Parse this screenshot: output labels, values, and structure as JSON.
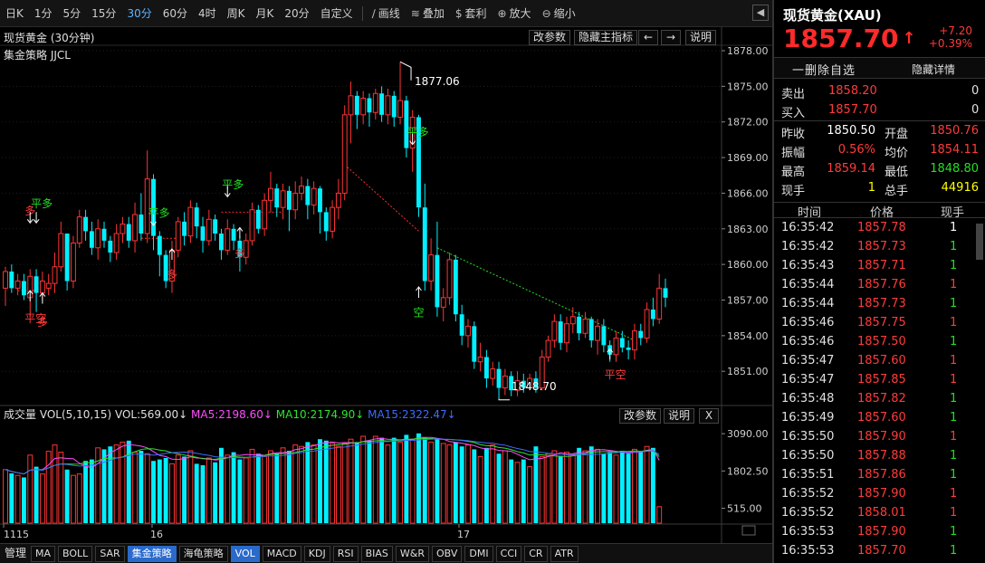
{
  "toolbar": {
    "items": [
      {
        "label": "日K",
        "active": false
      },
      {
        "label": "1分",
        "active": false
      },
      {
        "label": "5分",
        "active": false
      },
      {
        "label": "15分",
        "active": false
      },
      {
        "label": "30分",
        "active": true
      },
      {
        "label": "60分",
        "active": false
      },
      {
        "label": "4时",
        "active": false
      },
      {
        "label": "周K",
        "active": false
      },
      {
        "label": "月K",
        "active": false
      },
      {
        "label": "20分",
        "active": false
      },
      {
        "label": "自定义",
        "active": false
      }
    ],
    "tools": [
      {
        "icon": "draw-line-icon",
        "glyph": "∕",
        "label": "画线"
      },
      {
        "icon": "overlay-icon",
        "glyph": "≋",
        "label": "叠加"
      },
      {
        "icon": "arbitrage-icon",
        "glyph": "$",
        "label": "套利"
      },
      {
        "icon": "zoom-in-icon",
        "glyph": "⊕",
        "label": "放大"
      },
      {
        "icon": "zoom-out-icon",
        "glyph": "⊖",
        "label": "缩小"
      }
    ],
    "collapse_glyph": "◀"
  },
  "main_chart": {
    "title": "现货黄金 (30分钟)",
    "strategy": "集金策略 JJCL",
    "buttons": {
      "edit_params": "改参数",
      "hide_indicator": "隐藏主指标",
      "prev": "←",
      "next": "→",
      "help": "说明"
    },
    "high_label": "1877.06",
    "low_label": "1848.70",
    "signals": [
      "多",
      "平多",
      "平空",
      "多",
      "平多",
      "多",
      "平多",
      "多",
      "平多",
      "空",
      "平空"
    ]
  },
  "volume_panel": {
    "title": "成交量",
    "vol_label": "VOL(5,10,15)",
    "vol_value": "VOL:569.00↓",
    "ma5": "MA5:2198.60↓",
    "ma10": "MA10:2174.90↓",
    "ma15": "MA15:2322.47↓",
    "buttons": {
      "edit_params": "改参数",
      "help": "说明",
      "close": "X"
    },
    "axis_ticks": [
      "3090.00",
      "1802.50",
      "515.00"
    ]
  },
  "x_axis_labels": [
    "1115",
    "16",
    "17"
  ],
  "bottom_tabs": {
    "manage": "管理",
    "tabs": [
      "MA",
      "BOLL",
      "SAR",
      "集金策略",
      "海龟策略",
      "VOL",
      "MACD",
      "KDJ",
      "RSI",
      "BIAS",
      "W&R",
      "OBV",
      "DMI",
      "CCI",
      "CR",
      "ATR"
    ],
    "selected": [
      "集金策略",
      "VOL"
    ]
  },
  "chart_data": {
    "type": "candlestick",
    "y_ticks": [
      "1878.00",
      "1875.00",
      "1872.00",
      "1869.00",
      "1866.00",
      "1863.00",
      "1860.00",
      "1857.00",
      "1854.00",
      "1851.00"
    ],
    "ylim": [
      1848.5,
      1878.0
    ],
    "candles": [
      {
        "o": 1858.0,
        "c": 1859.4,
        "h": 1859.8,
        "l": 1856.5
      },
      {
        "o": 1859.4,
        "c": 1858.0,
        "h": 1860.0,
        "l": 1857.6
      },
      {
        "o": 1858.0,
        "c": 1858.6,
        "h": 1859.2,
        "l": 1857.4
      },
      {
        "o": 1858.6,
        "c": 1857.4,
        "h": 1859.2,
        "l": 1857.0
      },
      {
        "o": 1857.2,
        "c": 1859.0,
        "h": 1859.6,
        "l": 1855.6
      },
      {
        "o": 1859.0,
        "c": 1857.6,
        "h": 1859.6,
        "l": 1856.0
      },
      {
        "o": 1857.6,
        "c": 1858.6,
        "h": 1859.4,
        "l": 1857.0
      },
      {
        "o": 1858.0,
        "c": 1858.4,
        "h": 1859.2,
        "l": 1857.4
      },
      {
        "o": 1858.4,
        "c": 1859.8,
        "h": 1861.0,
        "l": 1857.6
      },
      {
        "o": 1859.8,
        "c": 1862.6,
        "h": 1863.6,
        "l": 1859.4
      },
      {
        "o": 1862.6,
        "c": 1858.6,
        "h": 1862.6,
        "l": 1857.8
      },
      {
        "o": 1858.6,
        "c": 1861.8,
        "h": 1862.4,
        "l": 1858.0
      },
      {
        "o": 1861.8,
        "c": 1864.0,
        "h": 1864.6,
        "l": 1861.4
      },
      {
        "o": 1864.0,
        "c": 1862.8,
        "h": 1864.6,
        "l": 1862.0
      },
      {
        "o": 1862.8,
        "c": 1861.4,
        "h": 1863.6,
        "l": 1860.8
      },
      {
        "o": 1861.4,
        "c": 1863.0,
        "h": 1863.8,
        "l": 1860.4
      },
      {
        "o": 1863.0,
        "c": 1862.0,
        "h": 1863.6,
        "l": 1861.4
      },
      {
        "o": 1862.0,
        "c": 1861.0,
        "h": 1862.4,
        "l": 1860.2
      },
      {
        "o": 1861.0,
        "c": 1862.6,
        "h": 1863.4,
        "l": 1860.4
      },
      {
        "o": 1862.6,
        "c": 1863.4,
        "h": 1864.0,
        "l": 1861.8
      },
      {
        "o": 1863.4,
        "c": 1862.0,
        "h": 1864.0,
        "l": 1861.4
      },
      {
        "o": 1862.0,
        "c": 1864.2,
        "h": 1865.2,
        "l": 1861.0
      },
      {
        "o": 1864.2,
        "c": 1862.6,
        "h": 1866.0,
        "l": 1862.0
      },
      {
        "o": 1862.6,
        "c": 1867.2,
        "h": 1869.6,
        "l": 1861.8
      },
      {
        "o": 1867.2,
        "c": 1862.4,
        "h": 1867.6,
        "l": 1861.2
      },
      {
        "o": 1862.4,
        "c": 1860.8,
        "h": 1862.8,
        "l": 1859.0
      },
      {
        "o": 1860.8,
        "c": 1858.6,
        "h": 1861.2,
        "l": 1858.0
      },
      {
        "o": 1858.6,
        "c": 1861.2,
        "h": 1862.0,
        "l": 1857.6
      },
      {
        "o": 1861.2,
        "c": 1863.6,
        "h": 1864.0,
        "l": 1860.6
      },
      {
        "o": 1863.6,
        "c": 1862.4,
        "h": 1864.4,
        "l": 1861.6
      },
      {
        "o": 1862.4,
        "c": 1864.8,
        "h": 1865.4,
        "l": 1861.8
      },
      {
        "o": 1864.8,
        "c": 1863.2,
        "h": 1865.2,
        "l": 1862.2
      },
      {
        "o": 1863.2,
        "c": 1862.0,
        "h": 1864.0,
        "l": 1861.0
      },
      {
        "o": 1862.0,
        "c": 1863.8,
        "h": 1864.6,
        "l": 1861.6
      },
      {
        "o": 1863.8,
        "c": 1862.6,
        "h": 1864.2,
        "l": 1862.0
      },
      {
        "o": 1862.6,
        "c": 1861.2,
        "h": 1863.0,
        "l": 1860.4
      },
      {
        "o": 1861.2,
        "c": 1863.0,
        "h": 1863.8,
        "l": 1860.8
      },
      {
        "o": 1863.0,
        "c": 1862.0,
        "h": 1863.4,
        "l": 1861.2
      },
      {
        "o": 1862.0,
        "c": 1860.6,
        "h": 1862.4,
        "l": 1859.4
      },
      {
        "o": 1860.6,
        "c": 1862.0,
        "h": 1862.6,
        "l": 1860.0
      },
      {
        "o": 1862.0,
        "c": 1864.6,
        "h": 1865.2,
        "l": 1861.6
      },
      {
        "o": 1864.6,
        "c": 1863.0,
        "h": 1865.0,
        "l": 1862.6
      },
      {
        "o": 1863.0,
        "c": 1865.4,
        "h": 1866.0,
        "l": 1862.4
      },
      {
        "o": 1865.4,
        "c": 1866.4,
        "h": 1867.8,
        "l": 1864.4
      },
      {
        "o": 1866.4,
        "c": 1864.8,
        "h": 1866.8,
        "l": 1864.0
      },
      {
        "o": 1864.8,
        "c": 1866.2,
        "h": 1866.8,
        "l": 1863.8
      },
      {
        "o": 1866.2,
        "c": 1864.6,
        "h": 1866.6,
        "l": 1862.8
      },
      {
        "o": 1864.6,
        "c": 1866.0,
        "h": 1867.0,
        "l": 1863.8
      },
      {
        "o": 1866.0,
        "c": 1866.6,
        "h": 1867.4,
        "l": 1865.4
      },
      {
        "o": 1866.6,
        "c": 1865.0,
        "h": 1867.2,
        "l": 1863.8
      },
      {
        "o": 1865.0,
        "c": 1866.4,
        "h": 1867.0,
        "l": 1864.2
      },
      {
        "o": 1866.4,
        "c": 1864.4,
        "h": 1866.6,
        "l": 1862.6
      },
      {
        "o": 1864.4,
        "c": 1862.8,
        "h": 1864.8,
        "l": 1862.0
      },
      {
        "o": 1862.8,
        "c": 1864.8,
        "h": 1865.4,
        "l": 1862.2
      },
      {
        "o": 1864.8,
        "c": 1866.0,
        "h": 1867.2,
        "l": 1863.8
      },
      {
        "o": 1866.0,
        "c": 1872.6,
        "h": 1873.4,
        "l": 1865.4
      },
      {
        "o": 1872.6,
        "c": 1874.2,
        "h": 1875.4,
        "l": 1870.2
      },
      {
        "o": 1874.2,
        "c": 1872.6,
        "h": 1874.6,
        "l": 1871.4
      },
      {
        "o": 1872.6,
        "c": 1874.0,
        "h": 1874.6,
        "l": 1871.8
      },
      {
        "o": 1874.0,
        "c": 1872.8,
        "h": 1874.4,
        "l": 1871.6
      },
      {
        "o": 1872.8,
        "c": 1874.4,
        "h": 1874.8,
        "l": 1872.2
      },
      {
        "o": 1874.4,
        "c": 1872.6,
        "h": 1875.0,
        "l": 1872.0
      },
      {
        "o": 1872.6,
        "c": 1874.2,
        "h": 1874.8,
        "l": 1871.8
      },
      {
        "o": 1874.2,
        "c": 1872.4,
        "h": 1874.6,
        "l": 1871.6
      },
      {
        "o": 1872.4,
        "c": 1873.8,
        "h": 1877.06,
        "l": 1871.8
      },
      {
        "o": 1873.8,
        "c": 1869.8,
        "h": 1874.2,
        "l": 1869.0
      },
      {
        "o": 1869.8,
        "c": 1872.4,
        "h": 1873.0,
        "l": 1867.8
      },
      {
        "o": 1872.4,
        "c": 1864.8,
        "h": 1872.6,
        "l": 1864.0
      },
      {
        "o": 1864.8,
        "c": 1858.6,
        "h": 1866.8,
        "l": 1857.8
      },
      {
        "o": 1858.6,
        "c": 1860.8,
        "h": 1862.2,
        "l": 1857.8
      },
      {
        "o": 1860.8,
        "c": 1856.4,
        "h": 1863.6,
        "l": 1855.6
      },
      {
        "o": 1856.4,
        "c": 1857.2,
        "h": 1858.0,
        "l": 1855.2
      },
      {
        "o": 1857.2,
        "c": 1860.4,
        "h": 1861.0,
        "l": 1856.6
      },
      {
        "o": 1860.4,
        "c": 1855.8,
        "h": 1860.8,
        "l": 1855.2
      },
      {
        "o": 1855.8,
        "c": 1854.0,
        "h": 1856.6,
        "l": 1853.2
      },
      {
        "o": 1854.0,
        "c": 1854.8,
        "h": 1855.4,
        "l": 1853.0
      },
      {
        "o": 1854.8,
        "c": 1851.8,
        "h": 1855.2,
        "l": 1851.2
      },
      {
        "o": 1851.8,
        "c": 1852.2,
        "h": 1853.4,
        "l": 1851.0
      },
      {
        "o": 1852.2,
        "c": 1850.4,
        "h": 1852.8,
        "l": 1849.6
      },
      {
        "o": 1850.4,
        "c": 1851.2,
        "h": 1851.8,
        "l": 1849.8
      },
      {
        "o": 1851.2,
        "c": 1849.6,
        "h": 1851.8,
        "l": 1848.7
      },
      {
        "o": 1849.6,
        "c": 1850.6,
        "h": 1851.2,
        "l": 1849.0
      },
      {
        "o": 1850.6,
        "c": 1849.4,
        "h": 1851.0,
        "l": 1848.9
      },
      {
        "o": 1849.4,
        "c": 1850.2,
        "h": 1851.0,
        "l": 1848.9
      },
      {
        "o": 1850.2,
        "c": 1849.6,
        "h": 1850.8,
        "l": 1849.2
      },
      {
        "o": 1849.6,
        "c": 1850.4,
        "h": 1850.8,
        "l": 1849.4
      },
      {
        "o": 1850.4,
        "c": 1849.6,
        "h": 1851.0,
        "l": 1849.2
      },
      {
        "o": 1849.6,
        "c": 1852.2,
        "h": 1852.8,
        "l": 1849.4
      },
      {
        "o": 1852.2,
        "c": 1853.6,
        "h": 1854.0,
        "l": 1851.8
      },
      {
        "o": 1853.6,
        "c": 1855.2,
        "h": 1855.8,
        "l": 1853.0
      },
      {
        "o": 1855.2,
        "c": 1853.4,
        "h": 1855.8,
        "l": 1852.8
      },
      {
        "o": 1853.4,
        "c": 1855.0,
        "h": 1855.6,
        "l": 1852.6
      },
      {
        "o": 1855.0,
        "c": 1855.6,
        "h": 1856.4,
        "l": 1854.2
      },
      {
        "o": 1855.6,
        "c": 1854.2,
        "h": 1856.0,
        "l": 1853.6
      },
      {
        "o": 1854.2,
        "c": 1855.4,
        "h": 1856.0,
        "l": 1853.8
      },
      {
        "o": 1855.4,
        "c": 1853.6,
        "h": 1855.6,
        "l": 1853.0
      },
      {
        "o": 1853.6,
        "c": 1854.8,
        "h": 1855.4,
        "l": 1852.4
      },
      {
        "o": 1854.8,
        "c": 1853.2,
        "h": 1855.4,
        "l": 1852.6
      },
      {
        "o": 1853.2,
        "c": 1852.4,
        "h": 1853.6,
        "l": 1851.8
      },
      {
        "o": 1852.4,
        "c": 1853.8,
        "h": 1854.4,
        "l": 1851.8
      },
      {
        "o": 1853.8,
        "c": 1853.0,
        "h": 1854.4,
        "l": 1852.6
      },
      {
        "o": 1853.0,
        "c": 1852.8,
        "h": 1853.6,
        "l": 1852.0
      },
      {
        "o": 1852.8,
        "c": 1854.4,
        "h": 1855.0,
        "l": 1852.0
      },
      {
        "o": 1854.4,
        "c": 1853.8,
        "h": 1855.0,
        "l": 1853.2
      },
      {
        "o": 1853.8,
        "c": 1856.2,
        "h": 1856.8,
        "l": 1853.4
      },
      {
        "o": 1856.2,
        "c": 1855.4,
        "h": 1857.2,
        "l": 1854.8
      },
      {
        "o": 1855.4,
        "c": 1858.0,
        "h": 1859.2,
        "l": 1855.0
      },
      {
        "o": 1858.0,
        "c": 1857.2,
        "h": 1858.8,
        "l": 1856.4
      }
    ],
    "volume": [
      1850,
      1720,
      1650,
      1580,
      2350,
      1950,
      1700,
      2480,
      2700,
      2450,
      1850,
      1650,
      1700,
      2150,
      2200,
      2600,
      2550,
      2650,
      2700,
      2800,
      2850,
      2450,
      2500,
      2400,
      2150,
      2200,
      2250,
      2050,
      2350,
      2300,
      2500,
      2050,
      2000,
      2250,
      2100,
      2600,
      2350,
      2450,
      2200,
      2250,
      2550,
      2400,
      2300,
      2500,
      2400,
      2600,
      2500,
      2700,
      2650,
      2800,
      2700,
      2900,
      2850,
      2750,
      2650,
      2750,
      2900,
      2800,
      3000,
      2850,
      3000,
      2950,
      2700,
      2950,
      2800,
      3050,
      2900,
      3100,
      2950,
      2800,
      2900,
      2750,
      2700,
      2800,
      2650,
      2700,
      2550,
      2300,
      2600,
      2700,
      2400,
      2500,
      2200,
      2100,
      2200,
      1950,
      2650,
      2300,
      2400,
      2500,
      2300,
      2450,
      2350,
      2600,
      2500,
      2650,
      2550,
      2400,
      2450,
      2350,
      2500,
      2400,
      2550,
      2500,
      2650,
      2600,
      569
    ],
    "volume_ylim": [
      0,
      3500
    ]
  },
  "quote_panel": {
    "name": "现货黄金(XAU)",
    "price": "1857.70",
    "arrow": "↑",
    "change": "+7.20",
    "change_pct": "+0.39%",
    "delete_btn": "一删除自选",
    "hide_btn": "隐藏详情",
    "sell_label": "卖出",
    "sell_price": "1858.20",
    "sell_qty": "0",
    "buy_label": "买入",
    "buy_price": "1857.70",
    "buy_qty": "0",
    "stats": [
      {
        "l1": "昨收",
        "v1": "1850.50",
        "c1": "#ffffff",
        "l2": "开盘",
        "v2": "1850.76",
        "c2": "#ff3b3b"
      },
      {
        "l1": "振幅",
        "v1": "0.56%",
        "c1": "#ff3b3b",
        "l2": "均价",
        "v2": "1854.11",
        "c2": "#ff3b3b"
      },
      {
        "l1": "最高",
        "v1": "1859.14",
        "c1": "#ff3b3b",
        "l2": "最低",
        "v2": "1848.80",
        "c2": "#22e022"
      },
      {
        "l1": "现手",
        "v1": "1",
        "c1": "#ffff00",
        "l2": "总手",
        "v2": "44916",
        "c2": "#ffff00"
      }
    ],
    "ticks_header": {
      "time": "时间",
      "price": "价格",
      "qty": "现手"
    },
    "ticks": [
      {
        "t": "16:35:42",
        "p": "1857.78",
        "q": "1"
      },
      {
        "t": "16:35:42",
        "p": "1857.73",
        "q": "1"
      },
      {
        "t": "16:35:43",
        "p": "1857.71",
        "q": "1"
      },
      {
        "t": "16:35:44",
        "p": "1857.76",
        "q": "1"
      },
      {
        "t": "16:35:44",
        "p": "1857.73",
        "q": "1"
      },
      {
        "t": "16:35:46",
        "p": "1857.75",
        "q": "1"
      },
      {
        "t": "16:35:46",
        "p": "1857.50",
        "q": "1"
      },
      {
        "t": "16:35:47",
        "p": "1857.60",
        "q": "1"
      },
      {
        "t": "16:35:47",
        "p": "1857.85",
        "q": "1"
      },
      {
        "t": "16:35:48",
        "p": "1857.82",
        "q": "1"
      },
      {
        "t": "16:35:49",
        "p": "1857.60",
        "q": "1"
      },
      {
        "t": "16:35:50",
        "p": "1857.90",
        "q": "1"
      },
      {
        "t": "16:35:50",
        "p": "1857.88",
        "q": "1"
      },
      {
        "t": "16:35:51",
        "p": "1857.86",
        "q": "1"
      },
      {
        "t": "16:35:52",
        "p": "1857.90",
        "q": "1"
      },
      {
        "t": "16:35:52",
        "p": "1858.01",
        "q": "1"
      },
      {
        "t": "16:35:53",
        "p": "1857.90",
        "q": "1"
      },
      {
        "t": "16:35:53",
        "p": "1857.70",
        "q": "1"
      }
    ],
    "colors": {
      "up": "#ff3b3b",
      "down": "#22e022",
      "neutral": "#ffffff"
    }
  }
}
